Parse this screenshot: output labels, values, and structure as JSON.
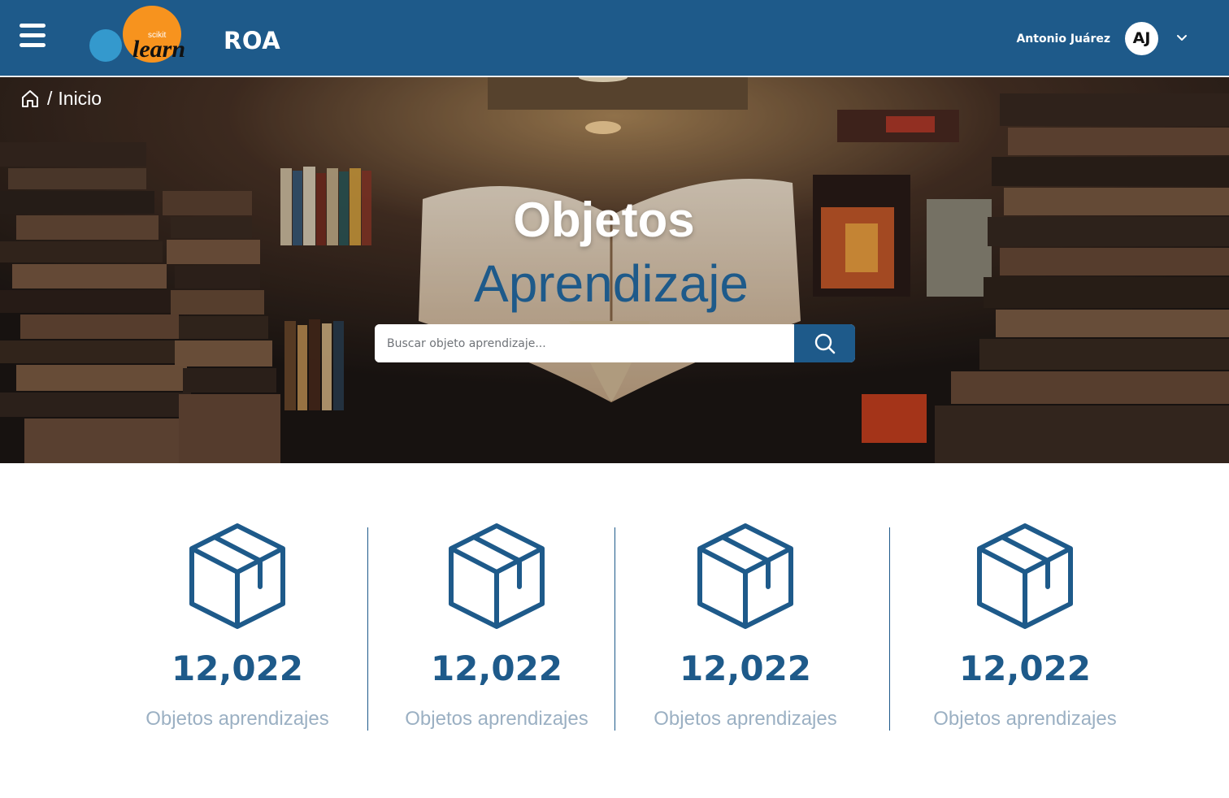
{
  "header": {
    "logo": {
      "brand_small": "scikit",
      "brand_main": "learn"
    },
    "app_title": "ROA",
    "user": {
      "name": "Antonio Juárez",
      "initials": "AJ"
    }
  },
  "breadcrumb": {
    "separator": "/",
    "current": "Inicio"
  },
  "hero": {
    "title_line1": "Objetos",
    "title_line2": "Aprendizaje",
    "search": {
      "placeholder": "Buscar objeto aprendizaje...",
      "value": ""
    }
  },
  "stats": [
    {
      "icon": "box-icon",
      "value": "12,022",
      "label": "Objetos aprendizajes"
    },
    {
      "icon": "box-icon",
      "value": "12,022",
      "label": "Objetos aprendizajes"
    },
    {
      "icon": "box-icon",
      "value": "12,022",
      "label": "Objetos aprendizajes"
    },
    {
      "icon": "box-icon",
      "value": "12,022",
      "label": "Objetos aprendizajes"
    }
  ],
  "colors": {
    "primary": "#1e5a8a",
    "stat_label": "#9bb0c3",
    "logo_orange": "#f7931e",
    "logo_blue": "#3499cd"
  }
}
